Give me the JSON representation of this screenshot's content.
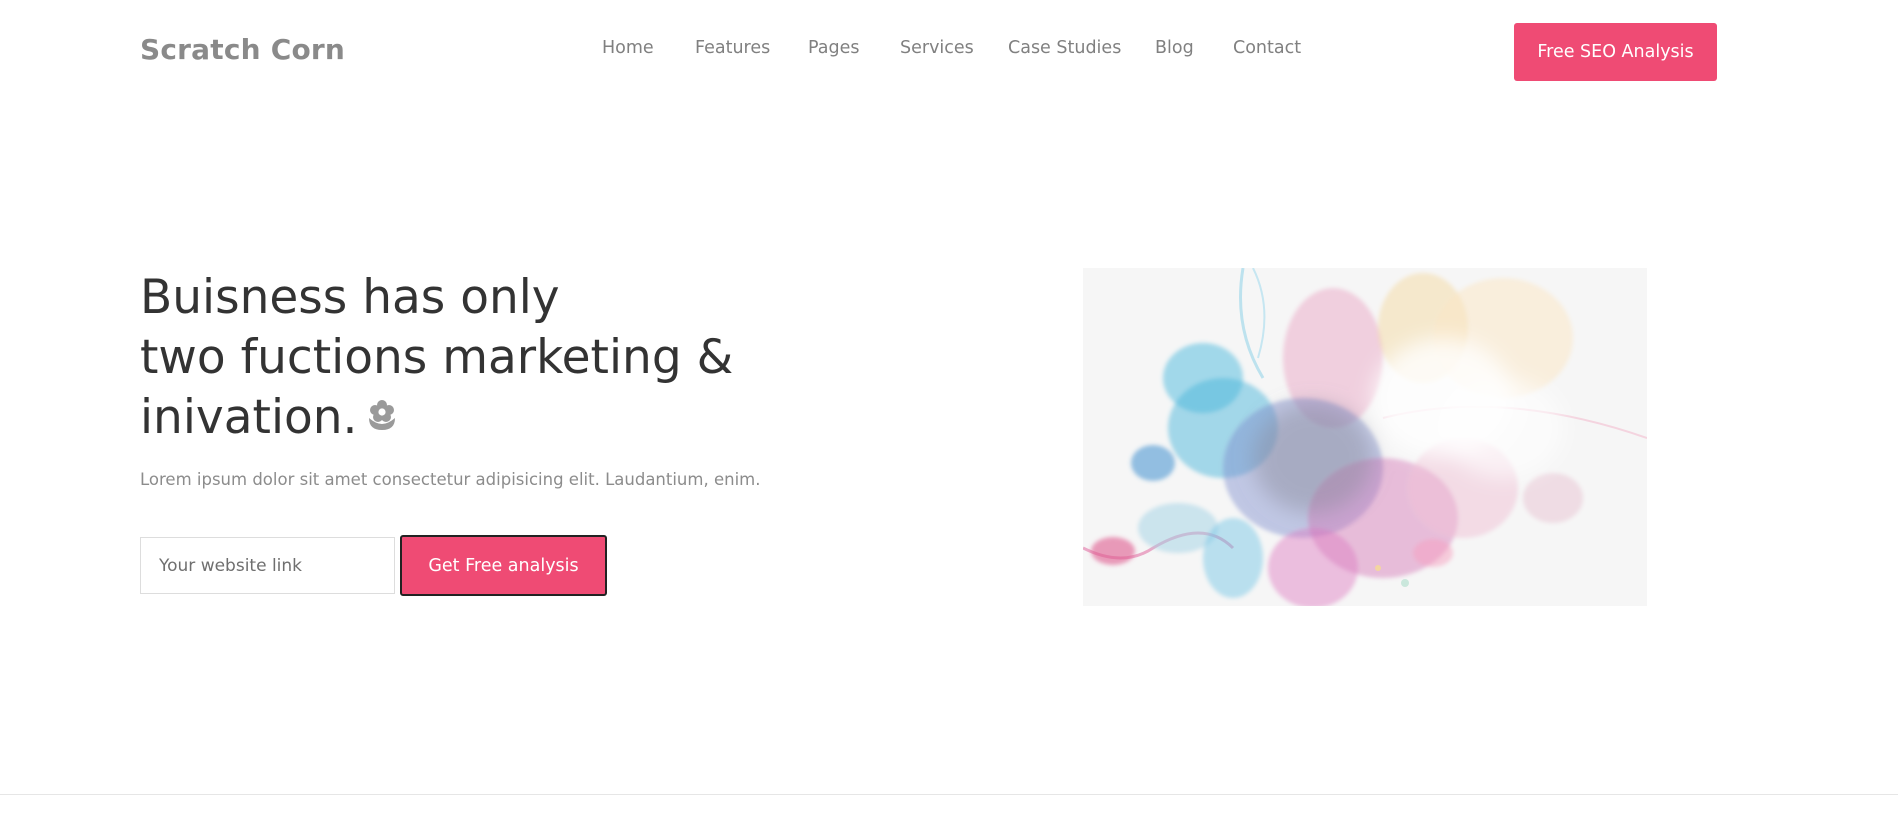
{
  "brand": {
    "name": "Scratch Corn"
  },
  "nav": {
    "items": [
      {
        "label": "Home"
      },
      {
        "label": "Features"
      },
      {
        "label": "Pages"
      },
      {
        "label": "Services"
      },
      {
        "label": "Case Studies"
      },
      {
        "label": "Blog"
      },
      {
        "label": "Contact"
      }
    ]
  },
  "header": {
    "cta_label": "Free SEO Analysis"
  },
  "hero": {
    "heading_lines": [
      "Buisness has only",
      "two fuctions marketing &",
      "inivation."
    ],
    "subtitle": "Lorem ipsum dolor sit amet consectetur adipisicing elit. Laudantium, enim.",
    "input_placeholder": "Your website link",
    "input_value": "",
    "cta_label": "Get Free analysis",
    "heading_icon": "flower-icon",
    "art": "abstract-ink-splash-image"
  },
  "colors": {
    "accent": "#ef4b74",
    "heading": "#333333",
    "nav_text": "#808080",
    "muted_text": "#8c8c8c",
    "brand_text": "#8a8a8a"
  }
}
